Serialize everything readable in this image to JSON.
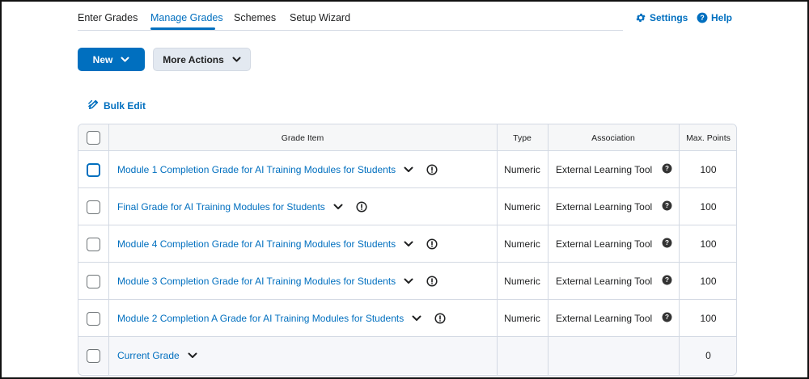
{
  "nav": {
    "tabs": [
      {
        "label": "Enter Grades"
      },
      {
        "label": "Manage Grades"
      },
      {
        "label": "Schemes"
      },
      {
        "label": "Setup Wizard"
      }
    ],
    "active_tab": "Manage Grades",
    "settings_label": "Settings",
    "help_label": "Help"
  },
  "toolbar": {
    "new_label": "New",
    "more_actions_label": "More Actions",
    "bulk_edit_label": "Bulk Edit"
  },
  "table": {
    "headers": {
      "item": "Grade Item",
      "type": "Type",
      "association": "Association",
      "max_points": "Max. Points"
    },
    "rows": [
      {
        "name": "Module 1 Completion Grade for AI Training Modules for Students",
        "type": "Numeric",
        "association": "External Learning Tool",
        "max_points": "100"
      },
      {
        "name": "Final Grade for AI Training Modules for Students",
        "type": "Numeric",
        "association": "External Learning Tool",
        "max_points": "100"
      },
      {
        "name": "Module 4 Completion Grade for AI Training Modules for Students",
        "type": "Numeric",
        "association": "External Learning Tool",
        "max_points": "100"
      },
      {
        "name": "Module 3 Completion Grade for AI Training Modules for Students",
        "type": "Numeric",
        "association": "External Learning Tool",
        "max_points": "100"
      },
      {
        "name": "Module 2 Completion A Grade for AI Training Modules for Students",
        "type": "Numeric",
        "association": "External Learning Tool",
        "max_points": "100"
      }
    ],
    "current_grade": {
      "name": "Current Grade",
      "max_points": "0"
    }
  },
  "colors": {
    "accent": "#006fbf",
    "border": "#d3d9e3",
    "secondary_button": "#e3e9f1"
  }
}
